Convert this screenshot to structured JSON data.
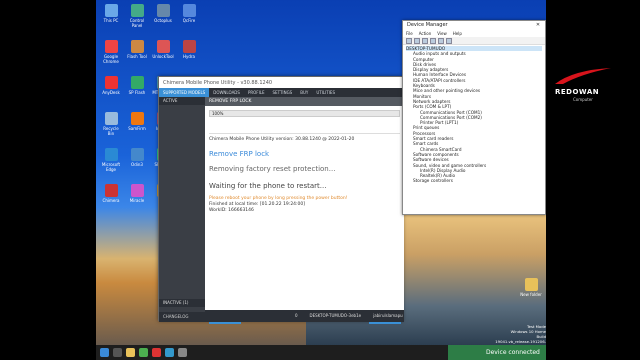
{
  "tool": {
    "title": "Chimera Mobile Phone Utility - v30.88.1240",
    "menu": [
      "SUPPORTED MODELS",
      "DOWNLOADS",
      "PROFILE",
      "SETTINGS",
      "BUY",
      "UTILITIES"
    ],
    "left_header": "ACTIVE",
    "left_bottom": "INACTIVE (1)",
    "changelog": "CHANGELOG",
    "section": "REMOVE FRP LOCK",
    "progress": "100%",
    "progress_value": 1.0,
    "log": {
      "version": "Chimera Mobile Phone Utility version: 30.88.1240 @ 2022-01-20",
      "op": "Remove FRP lock",
      "removing": "Removing factory reset protection...",
      "waiting": "Waiting for the phone to restart...",
      "reboot": "Please reboot your phone by long pressing the power button!",
      "finished": "Finished at local time: [01.20.22 19:24:00]",
      "workid": "WorkID: 166663146"
    },
    "hide_button": "Hide",
    "share_button": "Share",
    "status_user": "jabirulslamapu",
    "status_desktop": "DESKTOP-TUMUDO-3eb1e",
    "status_count": "0"
  },
  "device_manager": {
    "title": "Device Manager",
    "menu": [
      "File",
      "Action",
      "View",
      "Help"
    ],
    "root": "DESKTOP-TUMUDO",
    "nodes": [
      {
        "label": "Audio inputs and outputs",
        "level": 1
      },
      {
        "label": "Computer",
        "level": 1
      },
      {
        "label": "Disk drives",
        "level": 1
      },
      {
        "label": "Display adapters",
        "level": 1
      },
      {
        "label": "Human Interface Devices",
        "level": 1
      },
      {
        "label": "IDE ATA/ATAPI controllers",
        "level": 1
      },
      {
        "label": "Keyboards",
        "level": 1
      },
      {
        "label": "Mice and other pointing devices",
        "level": 1
      },
      {
        "label": "Monitors",
        "level": 1
      },
      {
        "label": "Network adapters",
        "level": 1
      },
      {
        "label": "Ports (COM & LPT)",
        "level": 1
      },
      {
        "label": "Communications Port (COM1)",
        "level": 2
      },
      {
        "label": "Communications Port (COM2)",
        "level": 2
      },
      {
        "label": "Printer Port (LPT1)",
        "level": 2
      },
      {
        "label": "Print queues",
        "level": 1
      },
      {
        "label": "Processors",
        "level": 1
      },
      {
        "label": "Smart card readers",
        "level": 1
      },
      {
        "label": "Smart cards",
        "level": 1
      },
      {
        "label": "Chimera SmartCard",
        "level": 2
      },
      {
        "label": "Software components",
        "level": 1
      },
      {
        "label": "Software devices",
        "level": 1
      },
      {
        "label": "Sound, video and game controllers",
        "level": 1
      },
      {
        "label": "Intel(R) Display Audio",
        "level": 2
      },
      {
        "label": "Realtek(R) Audio",
        "level": 2
      },
      {
        "label": "Storage controllers",
        "level": 1
      }
    ]
  },
  "brand": {
    "name": "REDOWAN",
    "sub": "Computer"
  },
  "desktop": {
    "icons": [
      "This PC",
      "Google Chrome",
      "AnyDesk",
      "Recycle Bin",
      "Microsoft Edge",
      "Chimera",
      "Control Panel",
      "Flash Tool",
      "SP Flash",
      "SamFirm",
      "Odin3",
      "Miracle",
      "Octoplus",
      "UnlockTool",
      "MTK Client",
      "Infinity",
      "SPD Tool",
      "Umt",
      "QcFire",
      "Hydra",
      "EFT Pro",
      "Sigma",
      "Pandora",
      "TFM Tool"
    ],
    "folder": "New folder",
    "test_mode": "Test Mode",
    "os": "Windows 10 Home",
    "build": "Build 19041.vb_release.191206-1406"
  },
  "toast": "Device connected"
}
